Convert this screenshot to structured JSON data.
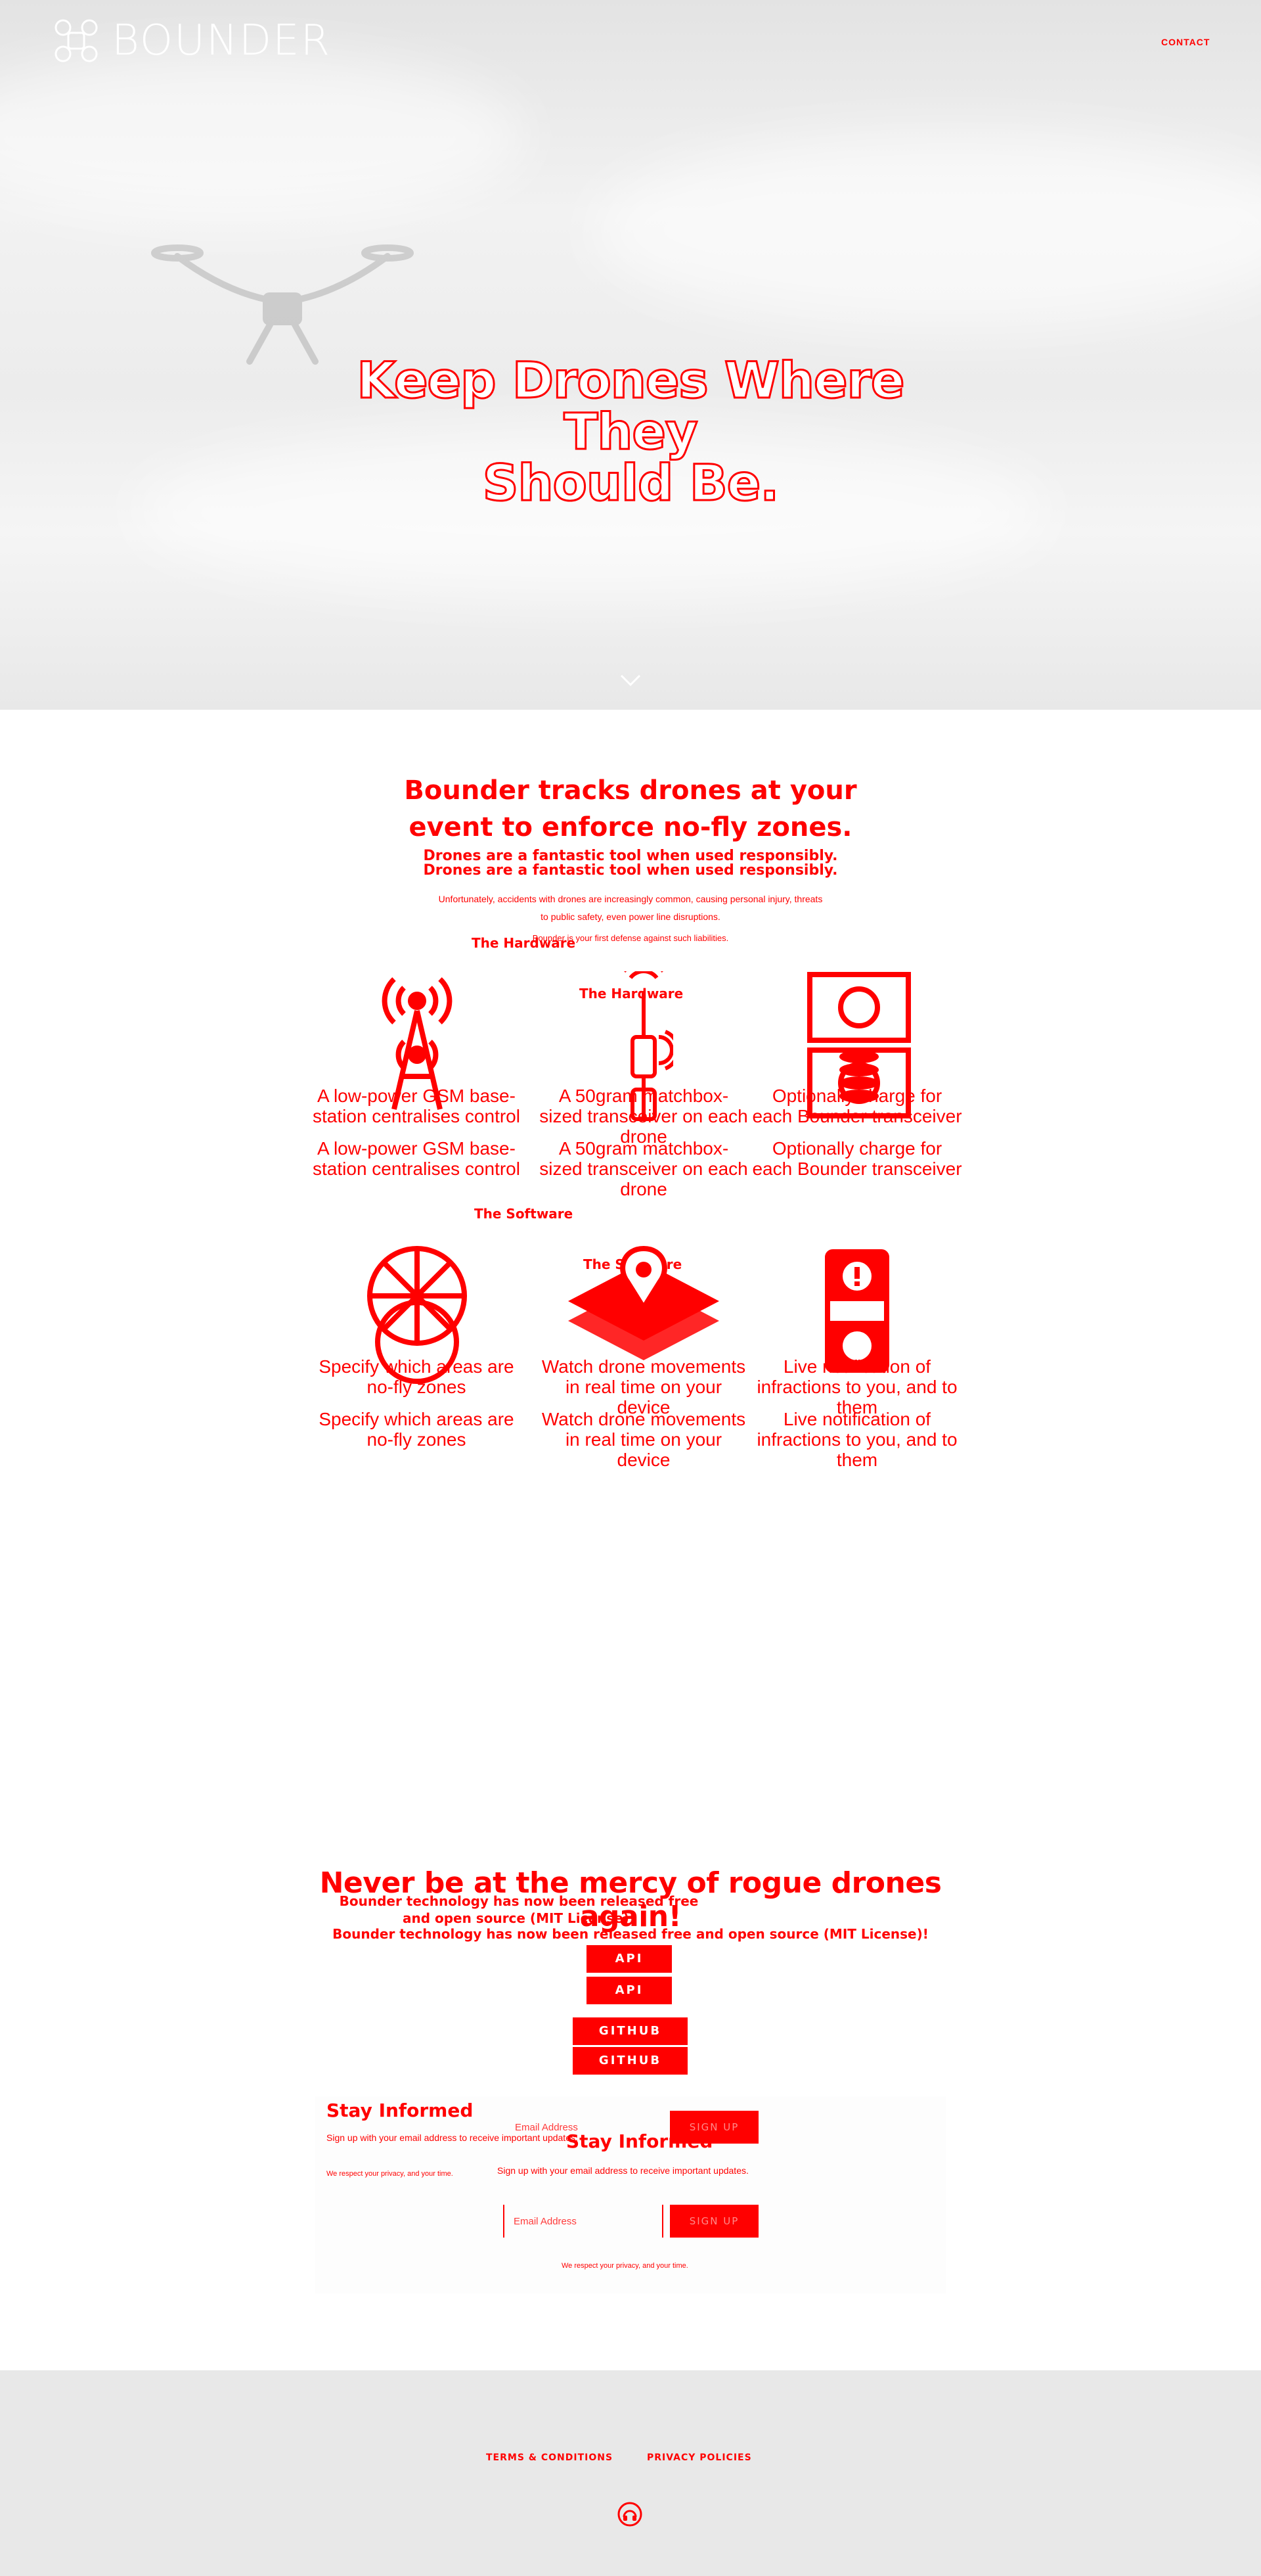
{
  "header": {
    "brand": "BOUNDER",
    "nav_contact": "CONTACT"
  },
  "hero": {
    "title_line1": "Keep Drones Where They",
    "title_line2": "Should Be.",
    "scroll_icon": "chevron-down-icon"
  },
  "intro": {
    "heading_line1": "Bounder tracks drones at your",
    "heading_line2": "event to enforce no-fly zones.",
    "subheading": "Drones are a fantastic tool when used responsibly.",
    "body_line1": "Unfortunately, accidents with drones are increasingly common, causing personal injury, threats",
    "body_line2": "to public safety, even power line disruptions.",
    "body_line3": "Bounder is your first defense against such liabilities."
  },
  "hardware": {
    "label": "The Hardware",
    "items": [
      {
        "icon": "radio-tower-icon",
        "text": "A low-power GSM base-station centralises control"
      },
      {
        "icon": "transceiver-icon",
        "text": "A 50gram matchbox-sized transceiver on each drone"
      },
      {
        "icon": "money-icon",
        "text": "Optionally charge for each Bounder transceiver"
      }
    ]
  },
  "software": {
    "label": "The Software",
    "items": [
      {
        "icon": "no-fly-zone-icon",
        "text": "Specify which areas are no-fly zones"
      },
      {
        "icon": "map-location-icon",
        "text": "Watch drone movements in real time on your device"
      },
      {
        "icon": "phone-alert-icon",
        "text": "Live notification of infractions to you, and to them"
      }
    ]
  },
  "open_source": {
    "heading": "Never be at the mercy of rogue drones again!",
    "subheading": "Bounder technology has now been released free and open source (MIT License)!",
    "buttons": [
      "API",
      "GITHUB"
    ]
  },
  "newsletter": {
    "title": "Stay Informed",
    "subtitle": "Sign up with your email address to receive important updates.",
    "email_placeholder": "Email Address",
    "submit_label": "SIGN UP",
    "privacy": "We respect your privacy, and your time."
  },
  "footer": {
    "links": [
      "TERMS & CONDITIONS",
      "PRIVACY POLICIES"
    ],
    "icon": "headphones-icon"
  },
  "colors": {
    "accent": "#ff0000",
    "footer_bg": "#e8e8e8",
    "hero_bg": "#ececec"
  }
}
